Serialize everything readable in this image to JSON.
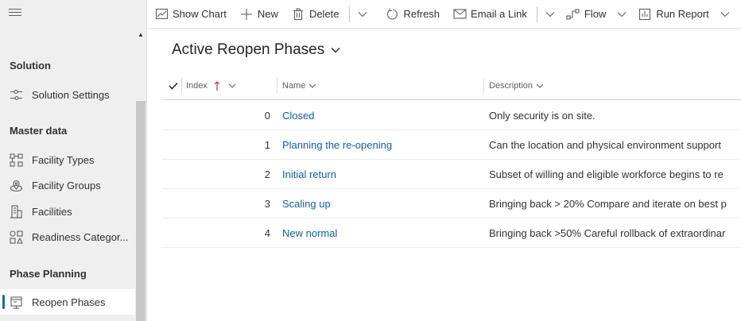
{
  "sidebar": {
    "groups": [
      {
        "title": "Solution",
        "items": [
          {
            "label": "Solution Settings",
            "icon": "settings-sliders-icon"
          }
        ]
      },
      {
        "title": "Master data",
        "items": [
          {
            "label": "Facility Types",
            "icon": "facility-types-icon"
          },
          {
            "label": "Facility Groups",
            "icon": "location-pin-icon"
          },
          {
            "label": "Facilities",
            "icon": "building-icon"
          },
          {
            "label": "Readiness Categor...",
            "icon": "categories-icon"
          }
        ]
      },
      {
        "title": "Phase Planning",
        "items": [
          {
            "label": "Reopen Phases",
            "icon": "calendar-icon",
            "selected": true
          }
        ]
      }
    ]
  },
  "commandbar": {
    "show_chart": "Show Chart",
    "new": "New",
    "delete": "Delete",
    "refresh": "Refresh",
    "email_link": "Email a Link",
    "flow": "Flow",
    "run_report": "Run Report"
  },
  "view": {
    "title": "Active Reopen Phases"
  },
  "grid": {
    "columns": {
      "index": "Index",
      "name": "Name",
      "description": "Description"
    },
    "sort": {
      "column": "Index",
      "direction": "ascending"
    },
    "rows": [
      {
        "index": "0",
        "name": "Closed",
        "description": "Only security is on site."
      },
      {
        "index": "1",
        "name": "Planning the re-opening",
        "description": "Can the location and physical environment support"
      },
      {
        "index": "2",
        "name": "Initial return",
        "description": "Subset of willing and eligible workforce begins to re"
      },
      {
        "index": "3",
        "name": "Scaling up",
        "description": "Bringing back > 20% Compare and iterate on best p"
      },
      {
        "index": "4",
        "name": "New normal",
        "description": "Bringing back >50% Careful rollback of extraordinar"
      }
    ]
  },
  "colors": {
    "accent": "#0f6cbd",
    "link": "#115ea3",
    "sidebar_bg": "#efefef"
  }
}
